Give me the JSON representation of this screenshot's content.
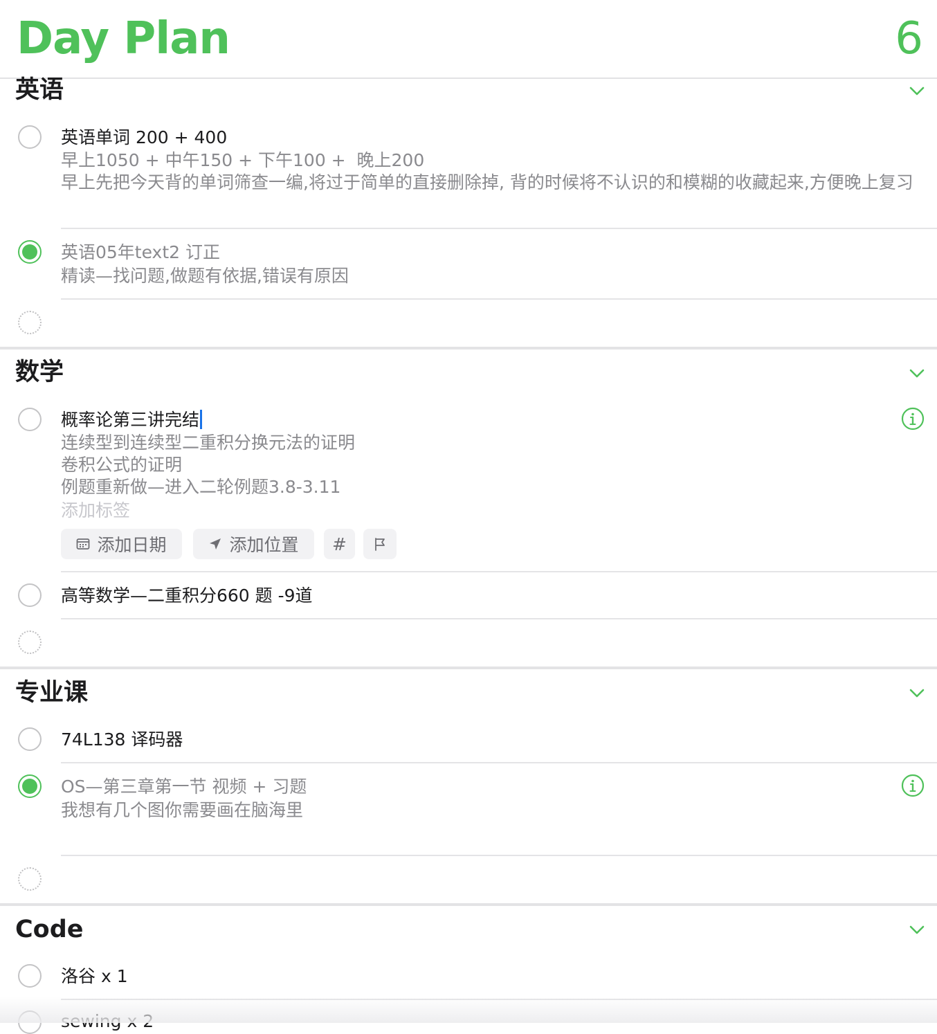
{
  "header": {
    "title": "Day Plan",
    "count": "6"
  },
  "sections": [
    {
      "title": "英语",
      "items": [
        {
          "title": "英语单词 200 + 400",
          "completed": false,
          "notes": "早上1050 + 中午150 + 下午100 +  晚上200\n早上先把今天背的单词筛查一编,将过于简单的直接删除掉, 背的时候将不认识的和模糊的收藏起来,方便晚上复习"
        },
        {
          "title": "英语05年text2 订正",
          "completed": true,
          "notes": "精读—找问题,做题有依据,错误有原因"
        }
      ]
    },
    {
      "title": "数学",
      "items": [
        {
          "title": "概率论第三讲完结",
          "completed": false,
          "editing": true,
          "notes": "连续型到连续型二重积分换元法的证明\n卷积公式的证明\n例题重新做—进入二轮例题3.8-3.11",
          "tag_placeholder": "添加标签",
          "actions": {
            "add_date": "添加日期",
            "add_location": "添加位置",
            "tag_symbol": "#"
          }
        },
        {
          "title": "高等数学—二重积分660 题 -9道",
          "completed": false
        }
      ]
    },
    {
      "title": "专业课",
      "items": [
        {
          "title": "74L138 译码器",
          "completed": false
        },
        {
          "title": "OS—第三章第一节 视频 + 习题",
          "completed": true,
          "notes": "我想有几个图你需要画在脑海里"
        }
      ]
    },
    {
      "title": "Code",
      "items": [
        {
          "title": "洛谷 x 1",
          "completed": false
        },
        {
          "title": "sewing x 2",
          "completed": false
        }
      ]
    }
  ],
  "colors": {
    "accent": "#4fc15a",
    "secondary_text": "#8a8a8e",
    "caret": "#1a73e8"
  },
  "icons": [
    "chevron-down-icon",
    "info-icon",
    "calendar-icon",
    "location-arrow-icon",
    "flag-icon"
  ]
}
